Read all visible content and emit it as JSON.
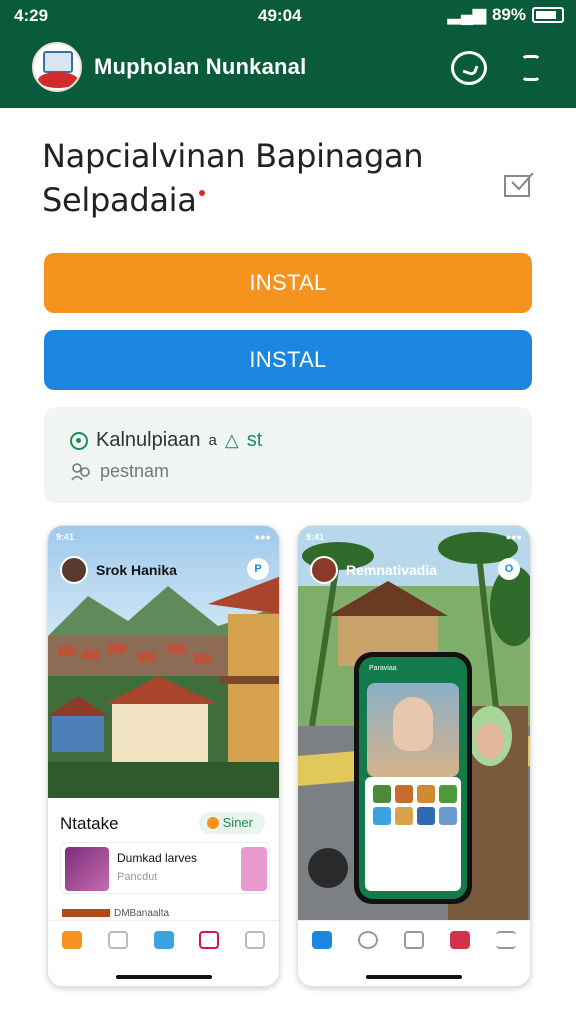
{
  "status_bar": {
    "time": "4:29",
    "center": "49:04",
    "battery": "89%"
  },
  "header": {
    "app_name": "Mupholan Nunkanal"
  },
  "title": {
    "line1": "Napcialvinan Bapinagan",
    "line2": "Selpadaia"
  },
  "buttons": {
    "install_primary": "INSTAL",
    "install_secondary": "INSTAL"
  },
  "info": {
    "row1": "Kalnulpiaan",
    "row1_suffix": "a",
    "row1_tag": "st",
    "row2": "pestnam"
  },
  "screenshots": [
    {
      "profile_name": "Srok Hanika",
      "badge": "P",
      "section_title": "Ntatake",
      "pill_label": "Siner",
      "list_title": "Dumkad larves",
      "list_subtitle": "Pancdut",
      "list_next": "DMBanaalta"
    },
    {
      "profile_name": "Remnativadia",
      "badge": "O",
      "phone_header": "Paraviaa"
    }
  ],
  "colors": {
    "header_bg": "#0a5a3c",
    "orange": "#f6921e",
    "blue": "#1b86e0",
    "accent_green": "#1f8a5a"
  },
  "icons": [
    "chat-icon",
    "menu-icon",
    "edit-icon",
    "clock-icon",
    "people-icon",
    "home-icon",
    "heart-icon"
  ]
}
